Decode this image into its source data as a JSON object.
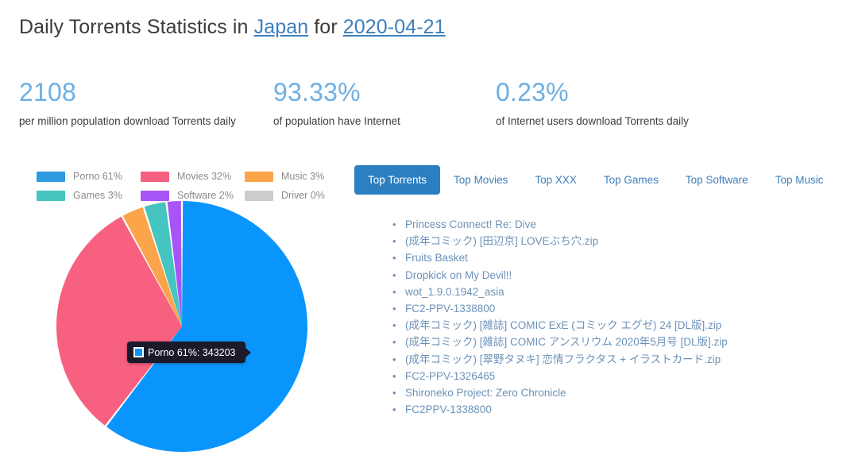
{
  "header": {
    "prefix": "Daily Torrents Statistics in ",
    "country": "Japan",
    "middle": " for ",
    "date": "2020-04-21"
  },
  "stats": [
    {
      "value": "2108",
      "label": "per million population download Torrents daily"
    },
    {
      "value": "93.33%",
      "label": "of population have Internet"
    },
    {
      "value": "0.23%",
      "label": "of Internet users download Torrents daily"
    }
  ],
  "legend": [
    {
      "label": "Porno 61%",
      "color": "#2e9ae0"
    },
    {
      "label": "Movies 32%",
      "color": "#f8607f"
    },
    {
      "label": "Music 3%",
      "color": "#fba44a"
    },
    {
      "label": "Games 3%",
      "color": "#45c4c0"
    },
    {
      "label": "Software 2%",
      "color": "#a855f7"
    },
    {
      "label": "Driver 0%",
      "color": "#cccccc"
    }
  ],
  "tooltip": {
    "text": "Porno 61%: 343203",
    "swatch_color": "#0a95fd"
  },
  "tabs": [
    {
      "label": "Top Torrents",
      "active": true
    },
    {
      "label": "Top Movies",
      "active": false
    },
    {
      "label": "Top XXX",
      "active": false
    },
    {
      "label": "Top Games",
      "active": false
    },
    {
      "label": "Top Software",
      "active": false
    },
    {
      "label": "Top Music",
      "active": false
    }
  ],
  "torrents": [
    "Princess Connect! Re: Dive",
    "(成年コミック) [田辺京] LOVEぶち穴.zip",
    "Fruits Basket",
    "Dropkick on My Devil!!",
    "wot_1.9.0.1942_asia",
    "FC2-PPV-1338800",
    "(成年コミック) [雑誌] COMIC ExE (コミック エグゼ) 24 [DL版].zip",
    "(成年コミック) [雑誌] COMIC アンスリウム 2020年5月号 [DL版].zip",
    "(成年コミック) [翠野タヌキ] 恋情フラクタス + イラストカード.zip",
    "FC2-PPV-1326465",
    "Shironeko Project: Zero Chronicle",
    "FC2PPV-1338800"
  ],
  "chart_data": {
    "type": "pie",
    "title": "Daily Torrents Statistics in Japan for 2020-04-21",
    "labels": [
      "Porno",
      "Movies",
      "Music",
      "Games",
      "Software",
      "Driver"
    ],
    "percentages": [
      61,
      32,
      3,
      3,
      2,
      0
    ],
    "values": [
      343203,
      180041,
      16879,
      16879,
      11253,
      0
    ],
    "colors": [
      "#0a95fd",
      "#f8607f",
      "#fba44a",
      "#45c4c0",
      "#a855f7",
      "#cccccc"
    ],
    "hovered_slice": "Porno",
    "hovered_value": 343203,
    "legend_position": "top",
    "start_angle_deg": 0,
    "direction": "clockwise"
  }
}
